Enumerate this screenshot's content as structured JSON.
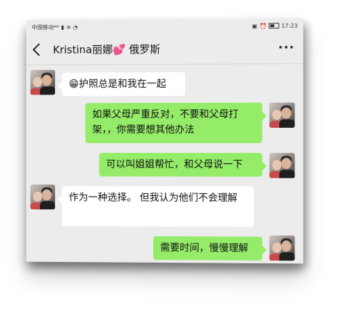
{
  "status_bar": {
    "carrier": "中国移动⁴⁶ᴵ",
    "icons_left": [
      "signal-icon",
      "wifi-icon",
      "notification-icon"
    ],
    "icons_right": [
      "hd-icon",
      "alarm-icon",
      "battery-icon"
    ],
    "time": "17:23"
  },
  "header": {
    "contact_name": "Kristina丽娜💕 俄罗斯",
    "back_icon": "chevron-left-icon",
    "more_icon": "more-dots-icon",
    "more_text": "···"
  },
  "messages": [
    {
      "side": "in",
      "text": "😁护照总是和我在一起"
    },
    {
      "side": "out",
      "text": "如果父母严重反对，不要和父母打架，，你需要想其他办法"
    },
    {
      "side": "out",
      "text": "可以叫姐姐帮忙，和父母说一下"
    },
    {
      "side": "in",
      "text": "作为一种选择。 但我认为他们不会理解"
    },
    {
      "side": "out",
      "text": "需要时间，慢慢理解"
    }
  ],
  "colors": {
    "chat_background": "#ececec",
    "incoming_bubble": "#ffffff",
    "outgoing_bubble": "#95ec69"
  }
}
